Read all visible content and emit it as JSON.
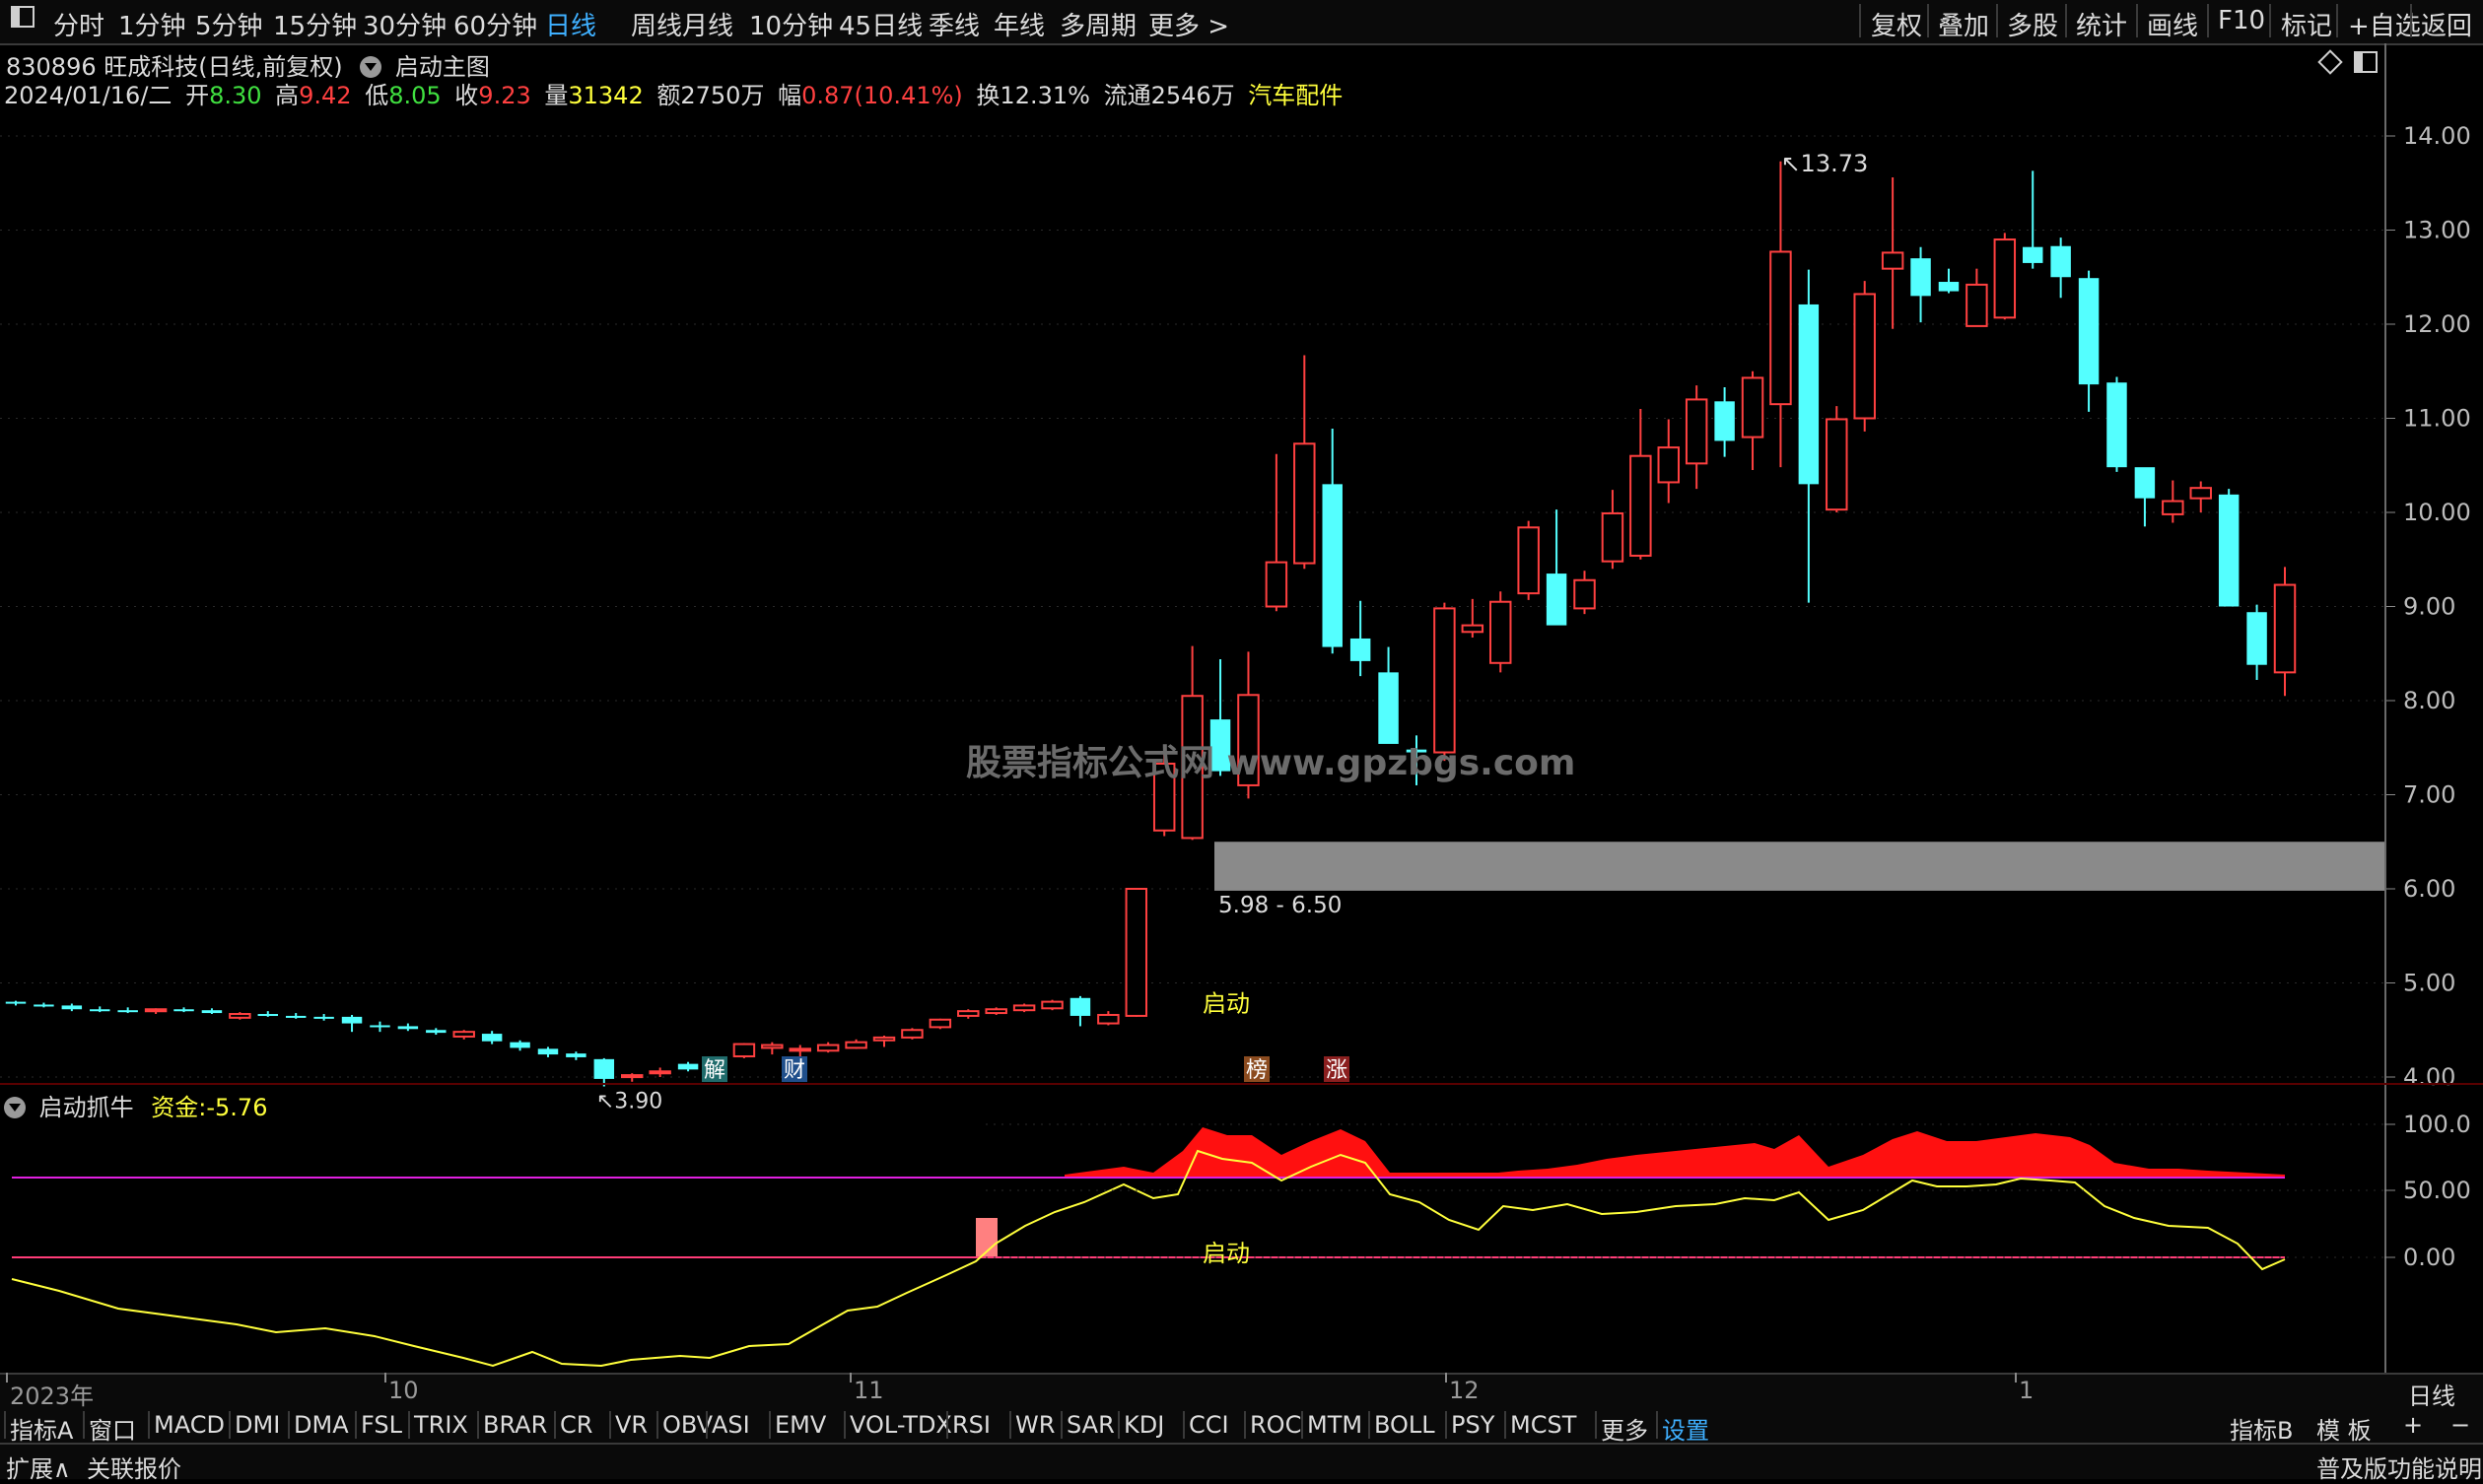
{
  "toolbar": {
    "periods": [
      "分时",
      "1分钟",
      "5分钟",
      "15分钟",
      "30分钟",
      "60分钟",
      "日线",
      "周线",
      "月线",
      "10分钟",
      "45日线",
      "季线",
      "年线",
      "多周期",
      "更多 >"
    ],
    "active_period": "日线",
    "right_items": [
      "复权",
      "叠加",
      "多股",
      "统计",
      "画线",
      "F10",
      "标记",
      "+自选",
      "返回"
    ]
  },
  "stock": {
    "code_name": "830896 旺成科技(日线,前复权)",
    "main_chart_label": "启动主图"
  },
  "quote": {
    "date": "2024/01/16/二",
    "open_label": "开",
    "open": "8.30",
    "high_label": "高",
    "high": "9.42",
    "low_label": "低",
    "low": "8.05",
    "close_label": "收",
    "close": "9.23",
    "volume_label": "量",
    "volume": "31342",
    "amount_label": "额",
    "amount": "2750万",
    "change_label": "幅",
    "change": "0.87(10.41%)",
    "turnover_label": "换",
    "turnover": "12.31%",
    "float_label": "流通",
    "float": "2546万",
    "sector": "汽车配件"
  },
  "colors": {
    "up": "#ff4040",
    "down": "#54ffff",
    "yellow": "#ffff3c",
    "magenta": "#e020e0",
    "zone_gray": "#8a8a8a",
    "accent": "#3fb0ff"
  },
  "main_annotations": {
    "high_marker": "13.73",
    "low_marker": "3.90",
    "zone_label": "5.98 - 6.50",
    "start_label": "启动",
    "watermark": "股票指标公式网 www.gpzbgs.com",
    "event_tags": [
      "解",
      "财",
      "榜",
      "涨"
    ]
  },
  "indicator": {
    "name": "启动抓牛",
    "fund_label": "资金:",
    "fund_value": "-5.76",
    "start_label": "启动"
  },
  "x_dates": [
    "2023年",
    "10",
    "11",
    "12",
    "1"
  ],
  "bottom_tabs": [
    "指标A",
    "窗口",
    "MACD",
    "DMI",
    "DMA",
    "FSL",
    "TRIX",
    "BRAR",
    "CR",
    "VR",
    "OBV",
    "ASI",
    "EMV",
    "VOL-TDX",
    "RSI",
    "WR",
    "SAR",
    "KDJ",
    "CCI",
    "ROC",
    "MTM",
    "BOLL",
    "PSY",
    "MCST",
    "更多",
    "设置"
  ],
  "bottom_active": "设置",
  "bottom_right": [
    "指标B",
    "模 板",
    "+",
    "−"
  ],
  "status": {
    "left": [
      "扩展∧",
      "关联报价"
    ],
    "right": "普及版功能说明",
    "right_axis_label": "日线"
  },
  "chart_data": [
    {
      "type": "candlestick",
      "title": "830896 旺成科技(日线,前复权)",
      "ylim": [
        3.6,
        14.4
      ],
      "y_ticks": [
        "14.00",
        "13.00",
        "12.00",
        "11.00",
        "10.00",
        "9.00",
        "8.00",
        "7.00",
        "6.00",
        "5.00",
        "4.00"
      ],
      "grid": true,
      "ohlc": [
        [
          4.8,
          4.81,
          4.76,
          4.78
        ],
        [
          4.77,
          4.79,
          4.74,
          4.76
        ],
        [
          4.76,
          4.78,
          4.7,
          4.72
        ],
        [
          4.72,
          4.75,
          4.69,
          4.71
        ],
        [
          4.71,
          4.74,
          4.68,
          4.7
        ],
        [
          4.7,
          4.73,
          4.67,
          4.72
        ],
        [
          4.72,
          4.74,
          4.69,
          4.7
        ],
        [
          4.71,
          4.73,
          4.67,
          4.68
        ],
        [
          4.63,
          4.69,
          4.61,
          4.67
        ],
        [
          4.67,
          4.7,
          4.64,
          4.66
        ],
        [
          4.65,
          4.68,
          4.62,
          4.63
        ],
        [
          4.64,
          4.67,
          4.6,
          4.62
        ],
        [
          4.64,
          4.66,
          4.48,
          4.57
        ],
        [
          4.55,
          4.59,
          4.48,
          4.53
        ],
        [
          4.54,
          4.57,
          4.49,
          4.51
        ],
        [
          4.5,
          4.52,
          4.45,
          4.47
        ],
        [
          4.43,
          4.5,
          4.4,
          4.48
        ],
        [
          4.46,
          4.49,
          4.35,
          4.38
        ],
        [
          4.37,
          4.39,
          4.28,
          4.31
        ],
        [
          4.3,
          4.32,
          4.21,
          4.24
        ],
        [
          4.25,
          4.27,
          4.18,
          4.21
        ],
        [
          4.19,
          4.2,
          3.9,
          3.98
        ],
        [
          4.0,
          4.04,
          3.95,
          4.02
        ],
        [
          4.04,
          4.1,
          4.0,
          4.06
        ],
        [
          4.14,
          4.16,
          4.06,
          4.08
        ],
        [
          4.05,
          4.17,
          4.03,
          4.14
        ],
        [
          4.22,
          4.36,
          4.2,
          4.35
        ],
        [
          4.31,
          4.37,
          4.24,
          4.34
        ],
        [
          4.3,
          4.34,
          4.18,
          4.3
        ],
        [
          4.28,
          4.37,
          4.26,
          4.34
        ],
        [
          4.31,
          4.4,
          4.3,
          4.37
        ],
        [
          4.39,
          4.44,
          4.32,
          4.42
        ],
        [
          4.42,
          4.52,
          4.4,
          4.5
        ],
        [
          4.53,
          4.62,
          4.51,
          4.61
        ],
        [
          4.65,
          4.72,
          4.62,
          4.7
        ],
        [
          4.68,
          4.74,
          4.66,
          4.72
        ],
        [
          4.71,
          4.78,
          4.69,
          4.76
        ],
        [
          4.73,
          4.82,
          4.71,
          4.8
        ],
        [
          4.84,
          4.86,
          4.54,
          4.65
        ],
        [
          4.57,
          4.7,
          4.55,
          4.66
        ],
        [
          4.65,
          6.0,
          4.64,
          6.0
        ],
        [
          6.62,
          7.5,
          6.56,
          7.33
        ],
        [
          6.54,
          8.58,
          6.52,
          8.05
        ],
        [
          7.8,
          8.44,
          7.2,
          7.25
        ],
        [
          7.1,
          8.52,
          6.96,
          8.06
        ],
        [
          9.0,
          10.62,
          8.95,
          9.47
        ],
        [
          9.46,
          11.67,
          9.4,
          10.73
        ],
        [
          10.3,
          10.89,
          8.5,
          8.57
        ],
        [
          8.66,
          9.06,
          8.26,
          8.42
        ],
        [
          8.3,
          8.57,
          7.94,
          7.54
        ],
        [
          7.48,
          7.63,
          7.1,
          7.45
        ],
        [
          7.45,
          9.04,
          7.36,
          8.98
        ],
        [
          8.73,
          9.08,
          8.67,
          8.8
        ],
        [
          8.4,
          9.16,
          8.3,
          9.05
        ],
        [
          9.14,
          9.91,
          9.07,
          9.84
        ],
        [
          9.35,
          10.03,
          8.93,
          8.8
        ],
        [
          8.98,
          9.38,
          8.92,
          9.28
        ],
        [
          9.48,
          10.24,
          9.4,
          9.99
        ],
        [
          9.54,
          11.1,
          9.5,
          10.6
        ],
        [
          10.32,
          10.99,
          10.1,
          10.69
        ],
        [
          10.52,
          11.35,
          10.25,
          11.2
        ],
        [
          11.18,
          11.33,
          10.59,
          10.76
        ],
        [
          10.8,
          11.5,
          10.45,
          11.43
        ],
        [
          11.15,
          13.73,
          10.48,
          12.77
        ],
        [
          12.21,
          12.58,
          9.04,
          10.3
        ],
        [
          10.03,
          11.13,
          10.0,
          10.99
        ],
        [
          11.0,
          12.46,
          10.86,
          12.32
        ],
        [
          12.59,
          13.56,
          11.95,
          12.76
        ],
        [
          12.7,
          12.82,
          12.02,
          12.3
        ],
        [
          12.45,
          12.59,
          12.33,
          12.35
        ],
        [
          11.98,
          12.59,
          11.98,
          12.42
        ],
        [
          12.07,
          12.97,
          12.05,
          12.9
        ],
        [
          12.82,
          13.63,
          12.59,
          12.65
        ],
        [
          12.83,
          12.92,
          12.28,
          12.5
        ],
        [
          12.49,
          12.57,
          11.07,
          11.36
        ],
        [
          11.38,
          11.44,
          10.43,
          10.48
        ],
        [
          10.48,
          10.46,
          9.85,
          10.15
        ],
        [
          9.98,
          10.34,
          9.89,
          10.12
        ],
        [
          10.15,
          10.33,
          10.0,
          10.26
        ],
        [
          10.19,
          10.25,
          9.22,
          9.0
        ],
        [
          8.94,
          9.02,
          8.22,
          8.38
        ],
        [
          8.3,
          9.42,
          8.05,
          9.23
        ]
      ]
    },
    {
      "type": "line",
      "title": "启动抓牛",
      "ylim": [
        -1.2,
        1.2
      ],
      "y_ticks": [
        "100.0",
        "50.00",
        "0.00"
      ],
      "series": [
        {
          "name": "资金",
          "values": [
            -5.76
          ]
        }
      ]
    }
  ]
}
